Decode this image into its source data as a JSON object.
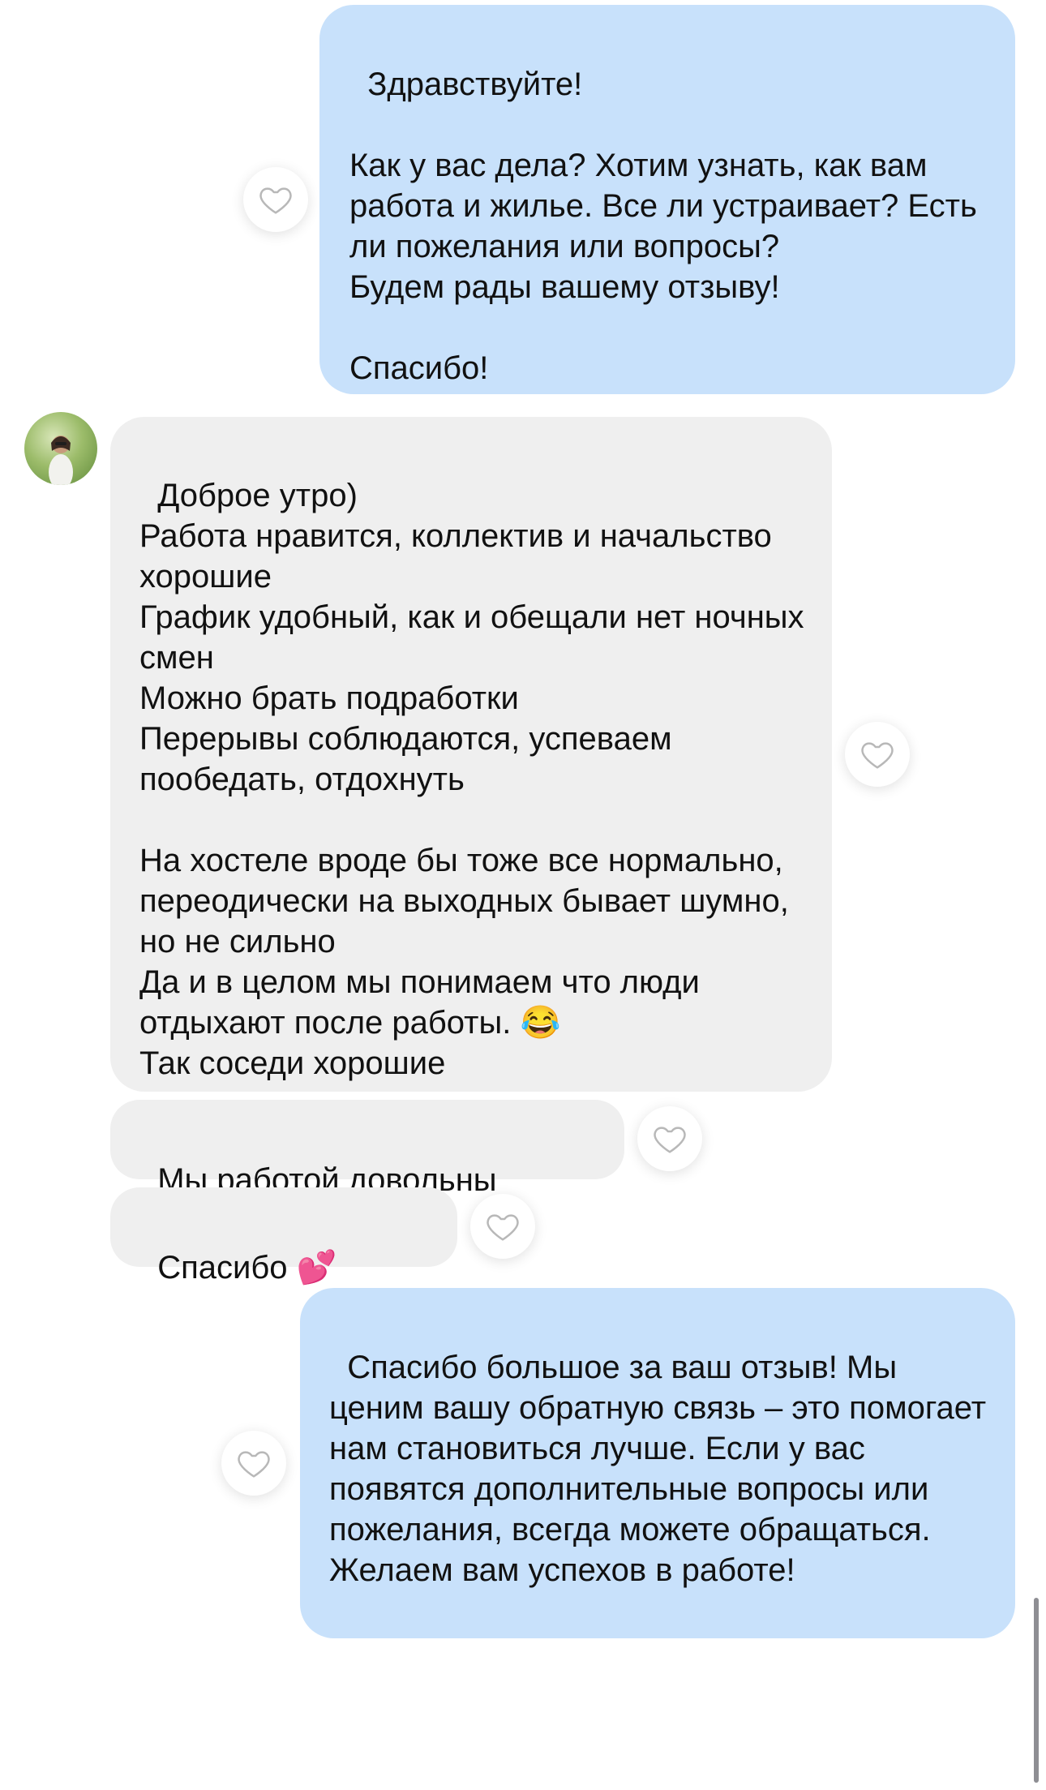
{
  "messages": {
    "m1": {
      "direction": "outgoing",
      "text": "Здравствуйте!\n\nКак у вас дела? Хотим узнать, как вам работа и жилье. Все ли устраивает? Есть ли пожелания или вопросы?\nБудем рады вашему отзыву!\n\nСпасибо!"
    },
    "m2": {
      "direction": "incoming",
      "text": "Доброе утро)\nРабота нравится, коллектив и начальство хорошие\nГрафик удобный, как и обещали нет ночных смен\nМожно брать подработки\nПерерывы соблюдаются, успеваем пообедать, отдохнуть\n\nНа хостеле вроде бы тоже все нормально, переодически на выходных бывает шумно, но не сильно\nДа и в целом мы понимаем что люди отдыхают после работы. 😂\nТак соседи хорошие"
    },
    "m3": {
      "direction": "incoming",
      "text": "Мы работой довольны"
    },
    "m4": {
      "direction": "incoming",
      "text": "Спасибо 💕"
    },
    "m5": {
      "direction": "outgoing",
      "text": "Спасибо большое за ваш отзыв! Мы ценим вашу обратную связь – это помогает нам становиться лучше. Если у вас появятся дополнительные вопросы или пожелания, всегда можете обращаться. Желаем вам успехов в работе!"
    }
  },
  "icons": {
    "like": "heart-outline-icon",
    "avatar": "sender-avatar"
  },
  "colors": {
    "outgoing_bubble": "#c8e1fb",
    "incoming_bubble": "#efefef",
    "heart_stroke": "#b8b8b8",
    "text": "#111111"
  }
}
